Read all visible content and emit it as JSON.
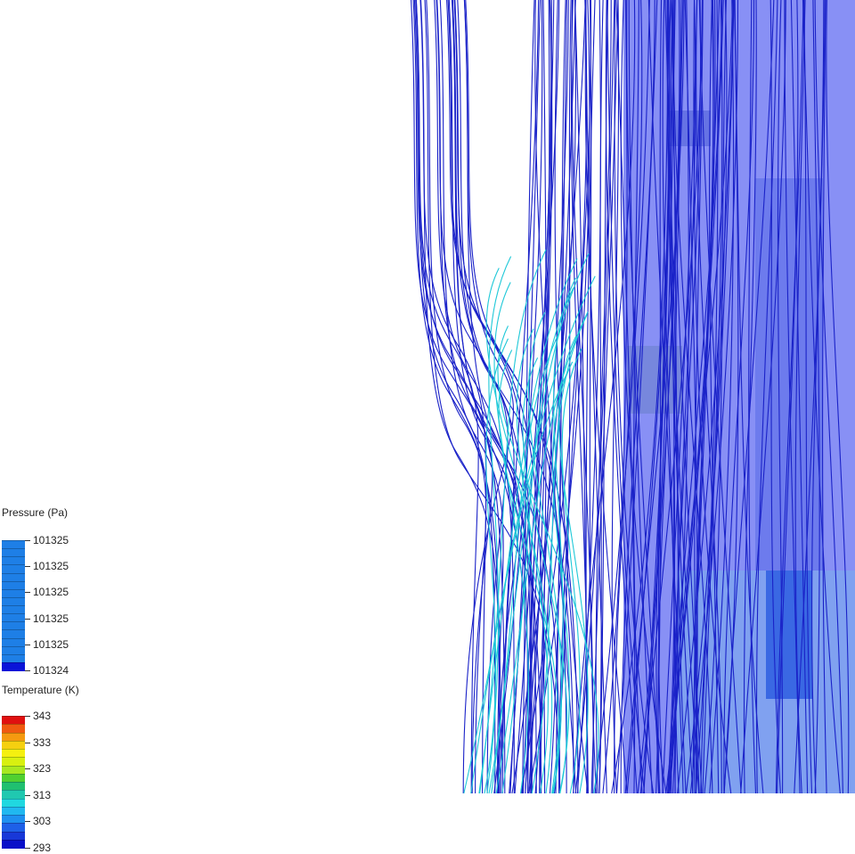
{
  "chart_data": {
    "type": "streamline-contour",
    "description_keys": [
      "legends"
    ],
    "colors": {
      "background": "#ffffff",
      "domain_fill": "#8890f5",
      "streamline_primary": "#1a22c8",
      "streamline_hot": "#1ec8d8",
      "pressure_low": "#0a14d8",
      "pressure_high": "#1e7fe6"
    },
    "legends": [
      {
        "id": "pressure",
        "title": "Pressure (Pa)",
        "min": 101324,
        "max": 101325,
        "tick_labels": [
          "101325",
          "101325",
          "101325",
          "101325",
          "101325",
          "101324"
        ],
        "colors": [
          "#1e7fe6",
          "#1e7fe6",
          "#1e7fe6",
          "#1e7fe6",
          "#1e7fe6",
          "#1e7fe6",
          "#1e7fe6",
          "#1e7fe6",
          "#1e7fe6",
          "#1e7fe6",
          "#1e7fe6",
          "#1e7fe6",
          "#1e7fe6",
          "#1e7fe6",
          "#1e7fe6",
          "#0a14d8"
        ]
      },
      {
        "id": "temperature",
        "title": "Temperature (K)",
        "min": 293,
        "max": 343,
        "tick_labels": [
          "343",
          "333",
          "323",
          "313",
          "303",
          "293"
        ],
        "colors": [
          "#e01010",
          "#f05a10",
          "#f59a10",
          "#f5d010",
          "#f5f010",
          "#d8f010",
          "#a8e820",
          "#50d030",
          "#20c070",
          "#20c8b0",
          "#20d8e0",
          "#20b8f0",
          "#1e90f0",
          "#1e60e8",
          "#1838d8",
          "#0a10c8"
        ]
      }
    ]
  }
}
